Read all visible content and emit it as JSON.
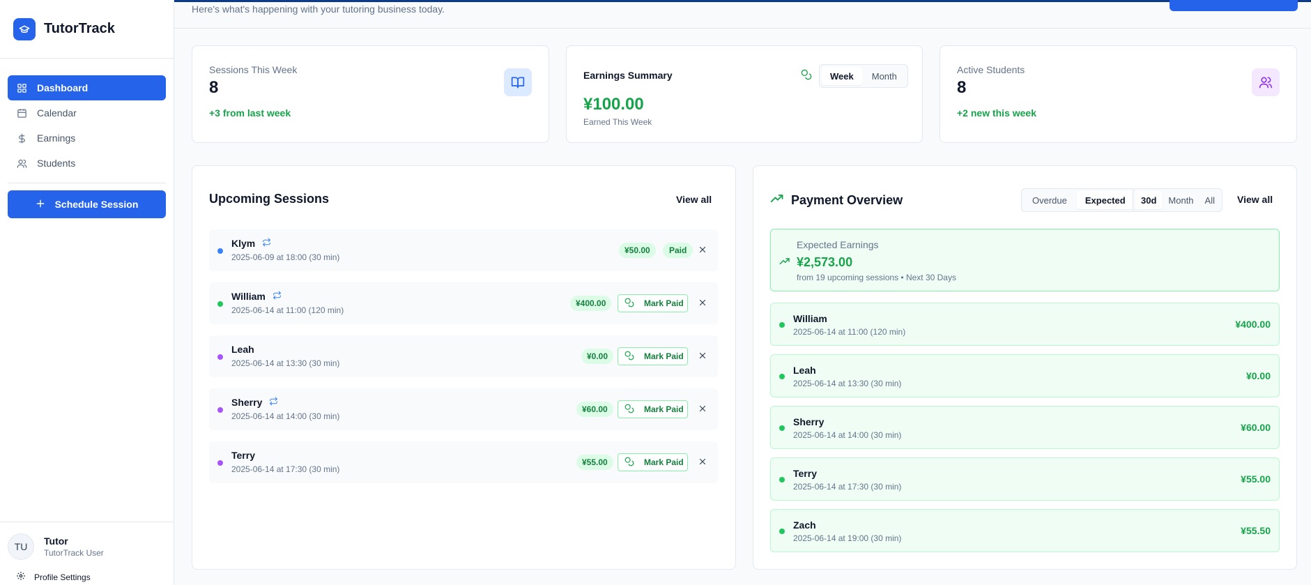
{
  "app": {
    "name": "TutorTrack"
  },
  "sidebar": {
    "items": [
      {
        "label": "Dashboard",
        "icon": "grid-icon",
        "active": true
      },
      {
        "label": "Calendar",
        "icon": "calendar-icon",
        "active": false
      },
      {
        "label": "Earnings",
        "icon": "dollar-icon",
        "active": false
      },
      {
        "label": "Students",
        "icon": "users-icon",
        "active": false
      }
    ],
    "schedule_label": "Schedule Session",
    "user": {
      "initials": "TU",
      "name": "Tutor",
      "role": "TutorTrack User"
    },
    "profile_label": "Profile Settings"
  },
  "header": {
    "subtitle": "Here's what's happening with your tutoring business today."
  },
  "stats": {
    "sessions": {
      "label": "Sessions This Week",
      "value": "8",
      "sub": "+3 from last week"
    },
    "earnings": {
      "title": "Earnings Summary",
      "tabs": [
        "Week",
        "Month"
      ],
      "active_tab": "Week",
      "value": "¥100.00",
      "caption": "Earned This Week"
    },
    "students": {
      "label": "Active Students",
      "value": "8",
      "sub": "+2 new this week"
    }
  },
  "upcoming": {
    "title": "Upcoming Sessions",
    "view_all": "View all",
    "mark_paid_label": "Mark Paid",
    "rows": [
      {
        "name": "Klym",
        "meta": "2025-06-09 at 18:00 (30 min)",
        "amount": "¥50.00",
        "status": "Paid",
        "recurring": true,
        "color": "#3b82f6"
      },
      {
        "name": "William",
        "meta": "2025-06-14 at 11:00 (120 min)",
        "amount": "¥400.00",
        "status": "unpaid",
        "recurring": true,
        "color": "#22c55e"
      },
      {
        "name": "Leah",
        "meta": "2025-06-14 at 13:30 (30 min)",
        "amount": "¥0.00",
        "status": "unpaid",
        "recurring": false,
        "color": "#a855f7"
      },
      {
        "name": "Sherry",
        "meta": "2025-06-14 at 14:00 (30 min)",
        "amount": "¥60.00",
        "status": "unpaid",
        "recurring": true,
        "color": "#a855f7"
      },
      {
        "name": "Terry",
        "meta": "2025-06-14 at 17:30 (30 min)",
        "amount": "¥55.00",
        "status": "unpaid",
        "recurring": false,
        "color": "#a855f7"
      }
    ]
  },
  "payment": {
    "title": "Payment Overview",
    "filter_tabs": [
      "Overdue",
      "Expected"
    ],
    "active_filter": "Expected",
    "range_tabs": [
      "30d",
      "Month",
      "All"
    ],
    "active_range": "30d",
    "view_all": "View all",
    "summary": {
      "label": "Expected Earnings",
      "value": "¥2,573.00",
      "caption": "from 19 upcoming sessions • Next 30 Days"
    },
    "rows": [
      {
        "name": "William",
        "meta": "2025-06-14 at 11:00 (120 min)",
        "amount": "¥400.00"
      },
      {
        "name": "Leah",
        "meta": "2025-06-14 at 13:30 (30 min)",
        "amount": "¥0.00"
      },
      {
        "name": "Sherry",
        "meta": "2025-06-14 at 14:00 (30 min)",
        "amount": "¥60.00"
      },
      {
        "name": "Terry",
        "meta": "2025-06-14 at 17:30 (30 min)",
        "amount": "¥55.00"
      },
      {
        "name": "Zach",
        "meta": "2025-06-14 at 19:00 (30 min)",
        "amount": "¥55.50"
      }
    ]
  },
  "colors": {
    "accent": "#2563eb",
    "success": "#16a34a",
    "success_bg": "#f0fdf4"
  }
}
